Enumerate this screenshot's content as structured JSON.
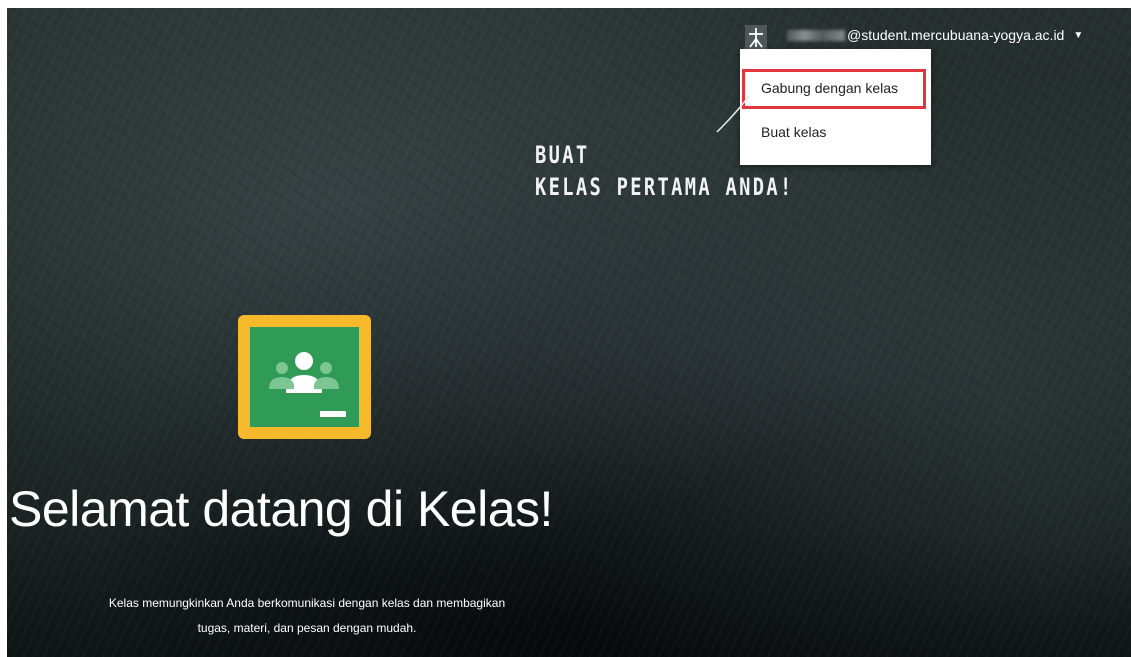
{
  "header": {
    "apps_icon": "person-apps-icon",
    "account_email": "@student.mercubuana-yogya.ac.id",
    "account_caret_icon": "caret-down-icon"
  },
  "menu": {
    "items": [
      {
        "label": "Gabung dengan kelas",
        "highlighted": true
      },
      {
        "label": "Buat kelas",
        "highlighted": false
      }
    ],
    "highlight_color": "#e2353c"
  },
  "annotation": {
    "line1": "Buat",
    "line2": "kelas pertama Anda!"
  },
  "logo": {
    "name": "google-classroom-logo",
    "frame_color": "#f7b92c",
    "board_color": "#2f9b56"
  },
  "welcome": {
    "title": "Selamat datang di Kelas!",
    "description_line1": "Kelas memungkinkan Anda berkomunikasi dengan kelas dan membagikan",
    "description_line2": "tugas, materi, dan pesan dengan mudah."
  }
}
